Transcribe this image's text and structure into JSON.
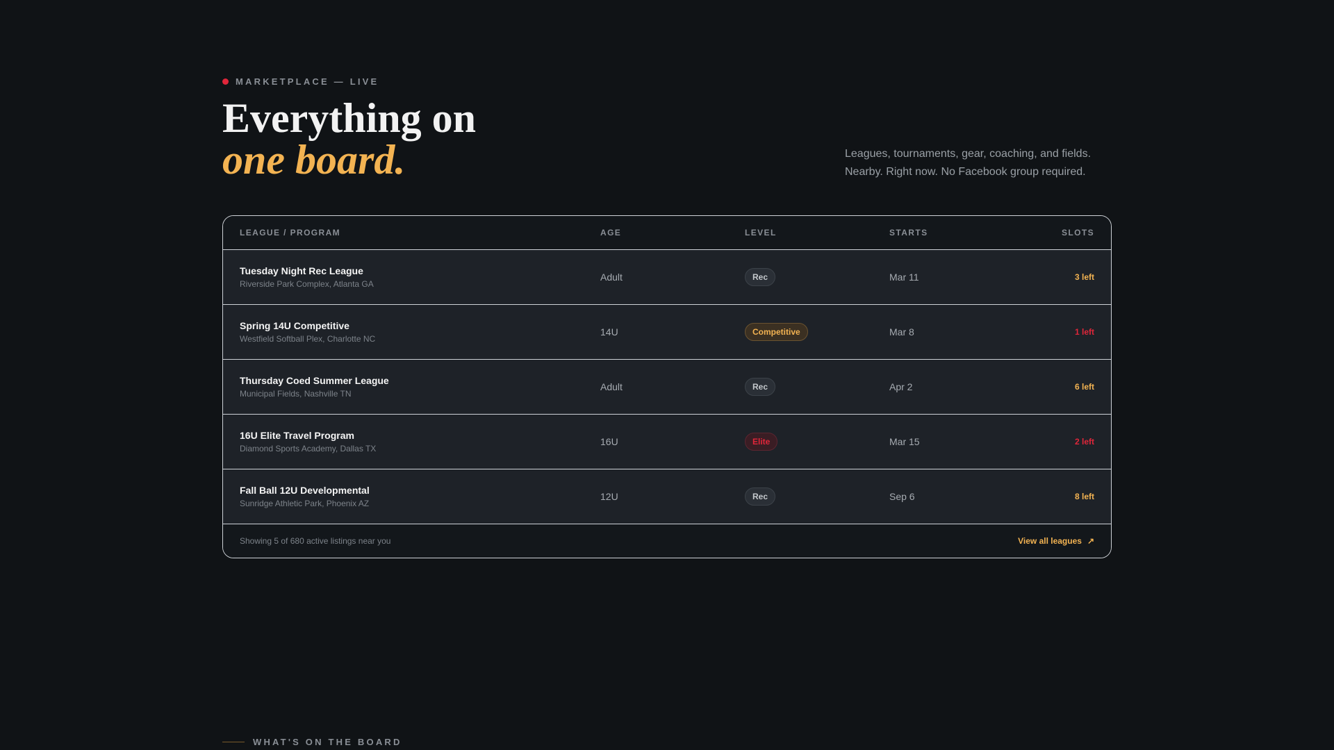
{
  "eyebrow": {
    "text": "MARKETPLACE — LIVE"
  },
  "headline": {
    "line1": "Everything on",
    "line2": "one board."
  },
  "subtext": {
    "line1": "Leagues, tournaments, gear, coaching, and fields.",
    "line2": "Nearby. Right now. No Facebook group required."
  },
  "table": {
    "headers": {
      "program": "LEAGUE / PROGRAM",
      "age": "AGE",
      "level": "LEVEL",
      "starts": "STARTS",
      "slots": "SLOTS"
    },
    "rows": [
      {
        "name": "Tuesday Night Rec League",
        "location": "Riverside Park Complex, Atlanta GA",
        "age": "Adult",
        "level": "Rec",
        "starts": "Mar 11",
        "slots": "3 left"
      },
      {
        "name": "Spring 14U Competitive",
        "location": "Westfield Softball Plex, Charlotte NC",
        "age": "14U",
        "level": "Competitive",
        "starts": "Mar 8",
        "slots": "1 left"
      },
      {
        "name": "Thursday Coed Summer League",
        "location": "Municipal Fields, Nashville TN",
        "age": "Adult",
        "level": "Rec",
        "starts": "Apr 2",
        "slots": "6 left"
      },
      {
        "name": "16U Elite Travel Program",
        "location": "Diamond Sports Academy, Dallas TX",
        "age": "16U",
        "level": "Elite",
        "starts": "Mar 15",
        "slots": "2 left"
      },
      {
        "name": "Fall Ball 12U Developmental",
        "location": "Sunridge Athletic Park, Phoenix AZ",
        "age": "12U",
        "level": "Rec",
        "starts": "Sep 6",
        "slots": "8 left"
      }
    ],
    "footer_note": "Showing 5 of 680 active listings near you",
    "view_all": "View all leagues"
  },
  "section_label": "WHAT'S ON THE BOARD",
  "colors": {
    "accent": "#f3b352",
    "alert": "#e0263a",
    "background": "#101316"
  },
  "icons": {
    "live": "live-dot-icon",
    "view_all": "arrow-up-right-icon"
  }
}
